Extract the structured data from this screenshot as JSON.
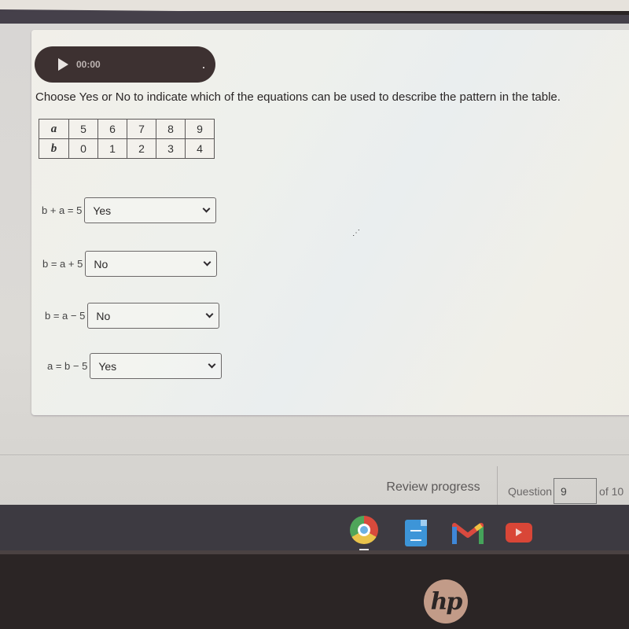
{
  "audio": {
    "play_icon": "play-icon",
    "time": "00:00"
  },
  "question": {
    "prompt": "Choose Yes or No to indicate which of the equations can be used to describe the pattern in the table.",
    "table": {
      "rows": [
        {
          "header": "a",
          "values": [
            "5",
            "6",
            "7",
            "8",
            "9"
          ]
        },
        {
          "header": "b",
          "values": [
            "0",
            "1",
            "2",
            "3",
            "4"
          ]
        }
      ]
    },
    "equations": [
      {
        "label": "b + a = 5",
        "selected": "Yes"
      },
      {
        "label": "b = a + 5",
        "selected": "No"
      },
      {
        "label": "b = a − 5",
        "selected": "No"
      },
      {
        "label": "a = b − 5",
        "selected": "Yes"
      }
    ]
  },
  "footer": {
    "review_label": "Review progress",
    "question_label": "Question",
    "question_number": "9",
    "of_label": "of 10"
  },
  "taskbar": {
    "apps": [
      "chrome-icon",
      "google-docs-icon",
      "gmail-icon",
      "youtube-icon"
    ]
  },
  "device": {
    "logo": "hp"
  }
}
